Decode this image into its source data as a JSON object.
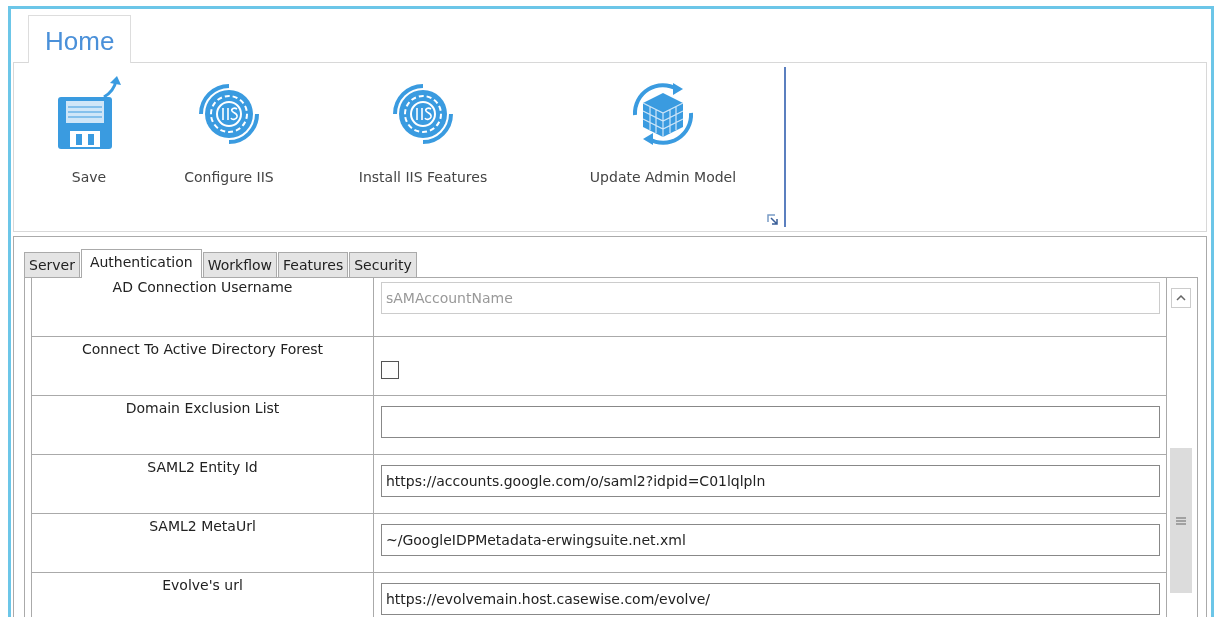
{
  "ribbon": {
    "tabs": [
      {
        "label": "Home",
        "selected": true
      }
    ],
    "buttons": [
      {
        "label": "Save",
        "kind": "save"
      },
      {
        "label": "Configure IIS",
        "kind": "iis"
      },
      {
        "label": "Install IIS Features",
        "kind": "iis"
      },
      {
        "label": "Update Admin Model",
        "kind": "model"
      }
    ]
  },
  "tabs": [
    {
      "label": "Server",
      "selected": false
    },
    {
      "label": "Authentication",
      "selected": true
    },
    {
      "label": "Workflow",
      "selected": false
    },
    {
      "label": "Features",
      "selected": false
    },
    {
      "label": "Security",
      "selected": false
    }
  ],
  "properties": [
    {
      "name": "AD Connection Username",
      "kind": "text",
      "placeholder": "sAMAccountName"
    },
    {
      "name": "Connect To Active Directory Forest",
      "kind": "checkbox",
      "checked": false
    },
    {
      "name": "Domain Exclusion List",
      "kind": "text"
    },
    {
      "name": "SAML2 Entity Id",
      "kind": "text",
      "value": "https://accounts.google.com/o/saml2?idpid=C01lqlpln"
    },
    {
      "name": "SAML2 MetaUrl",
      "kind": "text",
      "value": "~/GoogleIDPMetadata-erwingsuite.net.xml"
    },
    {
      "name": "Evolve's url",
      "kind": "text",
      "value": "https://evolvemain.host.casewise.com/evolve/"
    }
  ]
}
